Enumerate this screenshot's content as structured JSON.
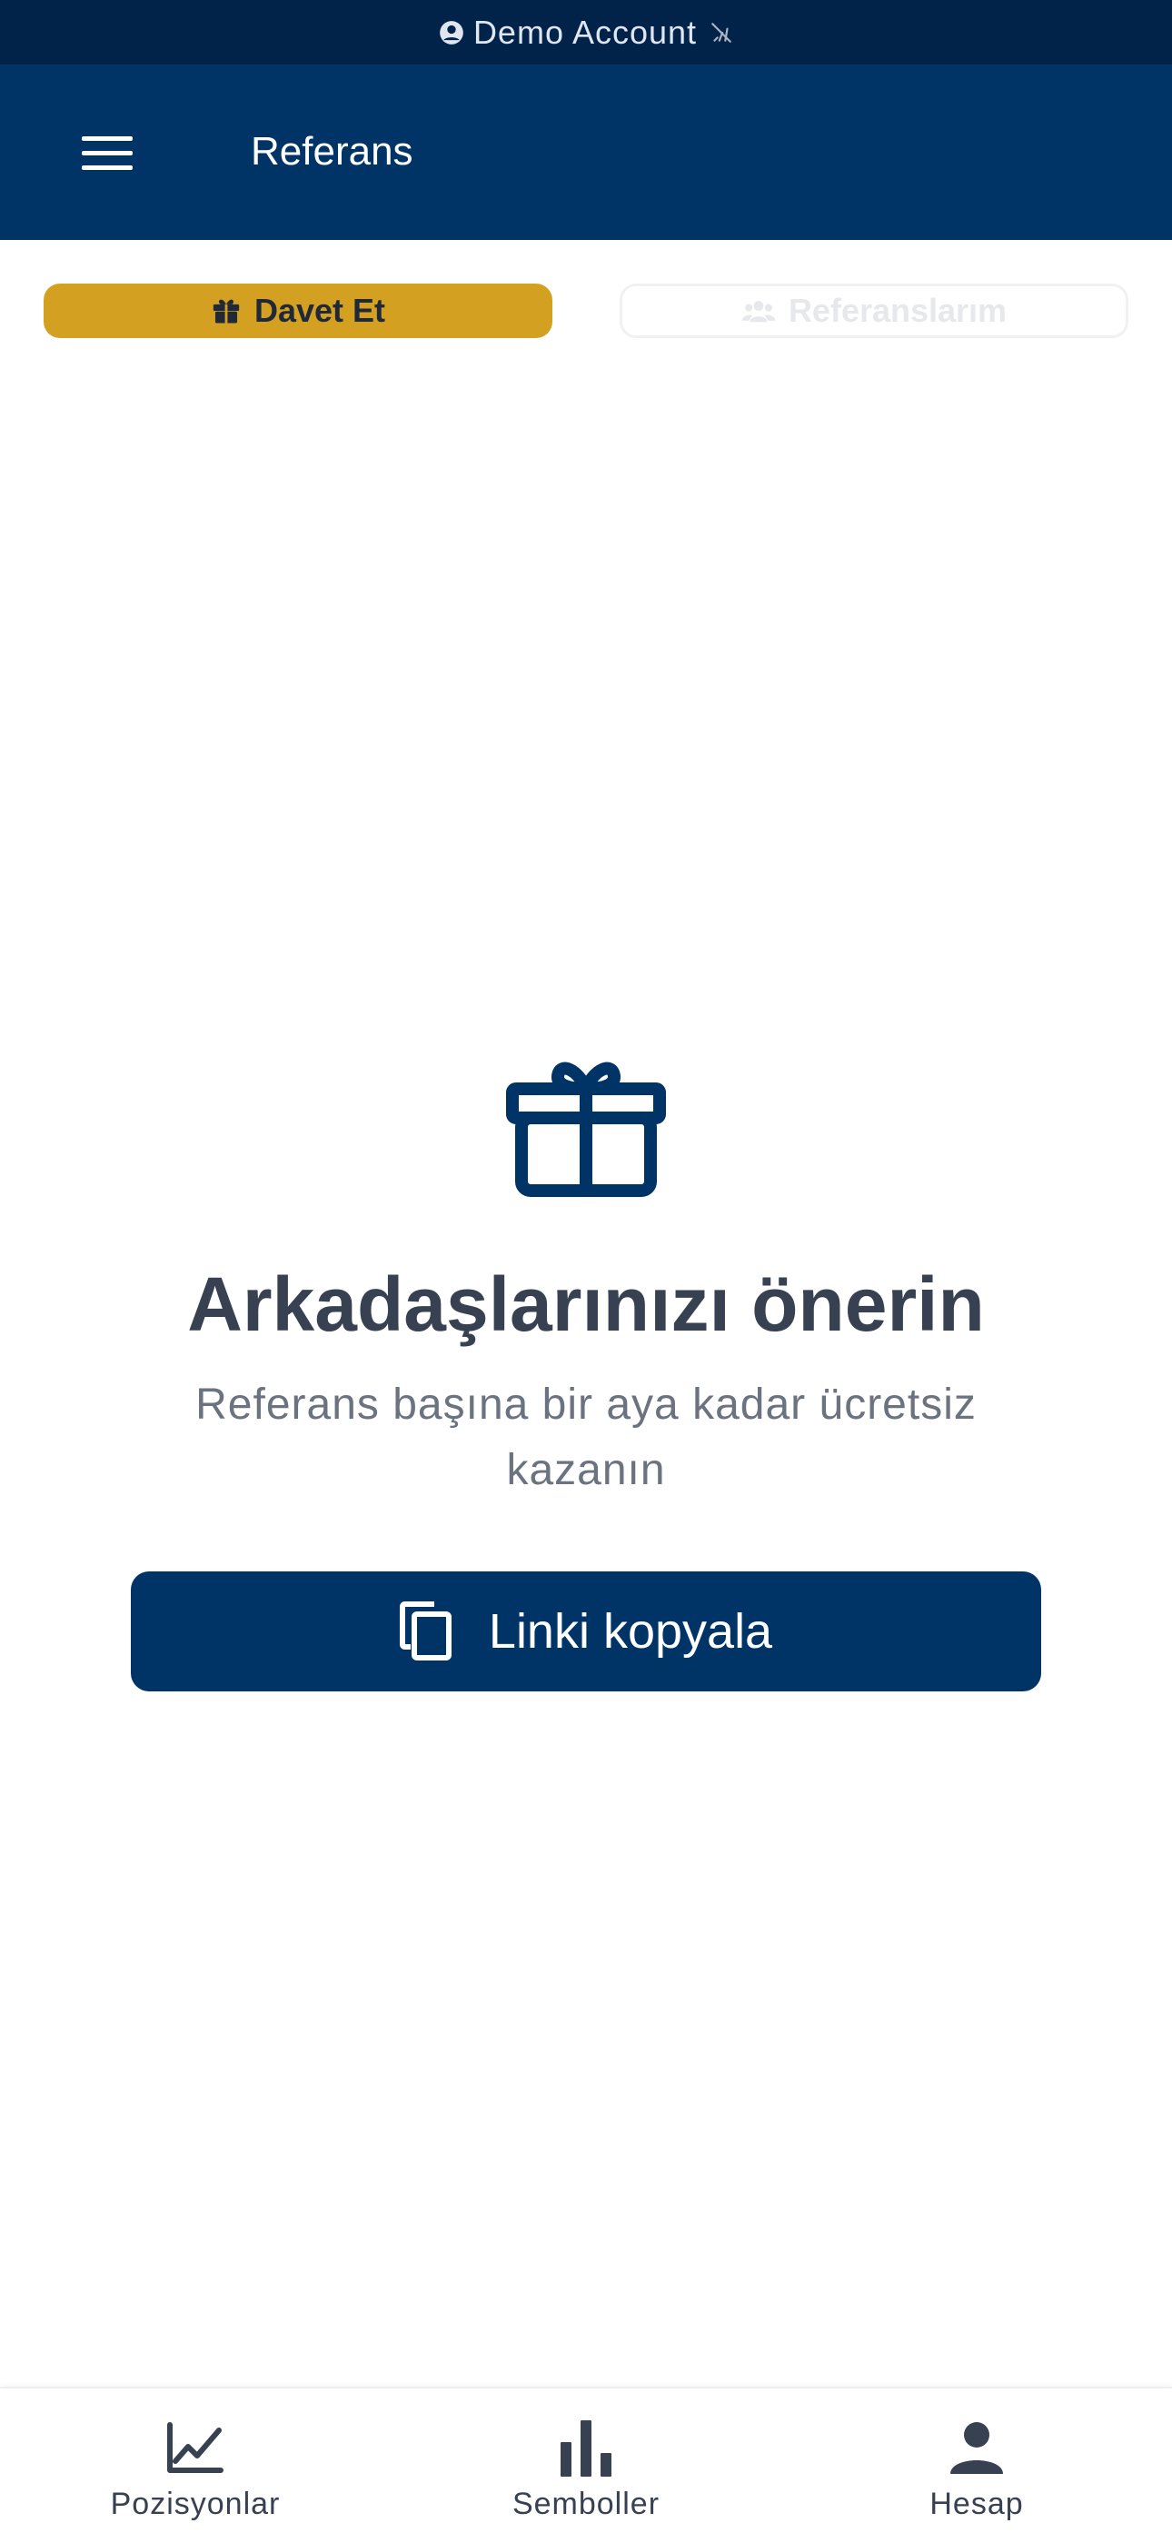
{
  "status_bar": {
    "account_label": "Demo Account"
  },
  "header": {
    "title": "Referans"
  },
  "tabs": [
    {
      "label": "Davet Et",
      "icon": "gift-icon",
      "active": true
    },
    {
      "label": "Referanslarım",
      "icon": "users-icon",
      "active": false
    }
  ],
  "hero": {
    "icon": "gift-icon",
    "title": "Arkadaşlarınızı önerin",
    "subtitle": "Referans başına bir aya kadar ücretsiz kazanın"
  },
  "copy_button": {
    "label": "Linki kopyala",
    "icon": "copy-icon"
  },
  "bottom_nav": [
    {
      "label": "Pozisyonlar",
      "icon": "line-chart-icon"
    },
    {
      "label": "Semboller",
      "icon": "bar-chart-icon"
    },
    {
      "label": "Hesap",
      "icon": "person-icon"
    }
  ],
  "colors": {
    "status_bar": "#012249",
    "header": "#003366",
    "accent_gold": "#d4a021",
    "primary": "#003366",
    "text_dark": "#374151",
    "text_muted": "#6b7280"
  }
}
